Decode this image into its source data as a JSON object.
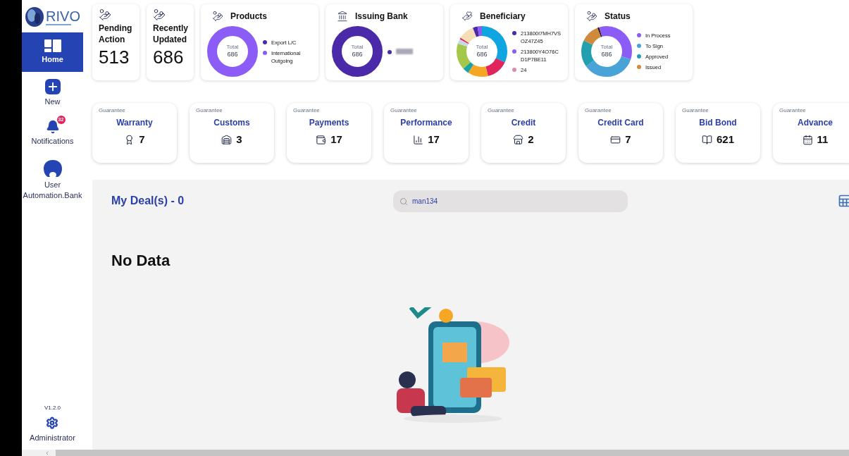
{
  "sidebar": {
    "logo": "RIVO",
    "items": [
      {
        "label": "Home",
        "selected": true,
        "kind": "home"
      },
      {
        "label": "New",
        "selected": false,
        "kind": "new"
      },
      {
        "label": "Notifications",
        "selected": false,
        "kind": "notifications",
        "badge": "32"
      },
      {
        "label": "User Automation.Bank",
        "selected": false,
        "kind": "user"
      }
    ],
    "version": "V1.2.0",
    "admin": {
      "label": "Administrator"
    }
  },
  "summary_cards": [
    {
      "title": "Pending Action",
      "value": "513"
    },
    {
      "title": "Recently Updated",
      "value": "686"
    }
  ],
  "chart_cards": [
    {
      "title": "Products",
      "total_label": "Total",
      "total": "686",
      "kind": "products",
      "legend": [
        {
          "label": "Export L/C",
          "color": "#4a2aa8"
        },
        {
          "label": "International Outgoing",
          "color": "#8b5cf6"
        }
      ]
    },
    {
      "title": "Issuing Bank",
      "total_label": "Total",
      "total": "686",
      "kind": "bank",
      "legend": [
        {
          "color": "#4a2aa8"
        }
      ]
    },
    {
      "title": "Beneficiary",
      "total_label": "Total",
      "total": "686",
      "kind": "beneficiary",
      "legend": [
        {
          "label": "213800I7MH7VS OZ47Z45",
          "color": "#4a2aa8"
        },
        {
          "label": "213800Y4O76C D1P7BE11",
          "color": "#8b5cf6"
        },
        {
          "label": "24",
          "color": "#d48fb0"
        }
      ]
    },
    {
      "title": "Status",
      "total_label": "Total",
      "total": "686",
      "kind": "status",
      "legend": [
        {
          "label": "In Process",
          "color": "#8b5cf6"
        },
        {
          "label": "To Sign",
          "color": "#4aa3d6"
        },
        {
          "label": "Approved",
          "color": "#22a0b0"
        },
        {
          "label": "Issued",
          "color": "#d08a3c"
        }
      ]
    }
  ],
  "guarantees": [
    {
      "caption": "Guarantee",
      "title": "Warranty",
      "count": "7"
    },
    {
      "caption": "Guarantee",
      "title": "Customs",
      "count": "3"
    },
    {
      "caption": "Guarantee",
      "title": "Payments",
      "count": "17"
    },
    {
      "caption": "Guarantee",
      "title": "Performance",
      "count": "17"
    },
    {
      "caption": "Guarantee",
      "title": "Credit",
      "count": "2"
    },
    {
      "caption": "Guarantee",
      "title": "Credit Card",
      "count": "7"
    },
    {
      "caption": "Guarantee",
      "title": "Bid Bond",
      "count": "621"
    },
    {
      "caption": "Guarantee",
      "title": "Advance",
      "count": "11"
    }
  ],
  "deals": {
    "title": "My Deal(s) - 0",
    "search": {
      "value": "man134"
    },
    "empty_message": "No Data"
  }
}
